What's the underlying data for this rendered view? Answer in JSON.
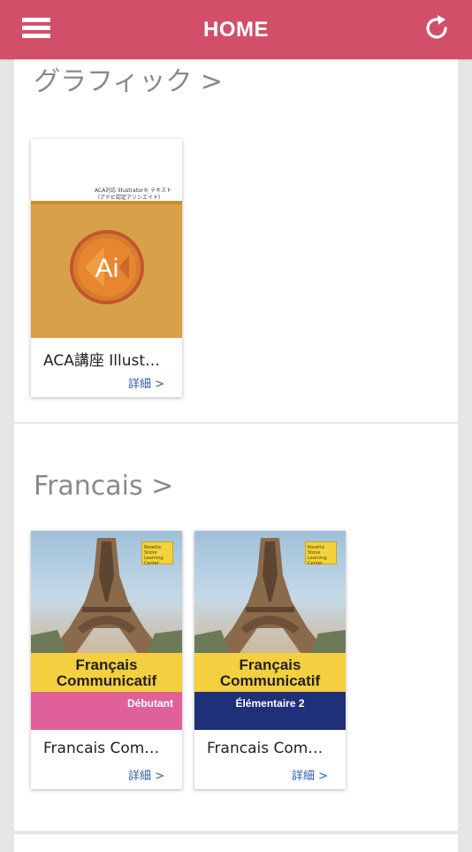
{
  "header": {
    "title": "HOME"
  },
  "sections": [
    {
      "title": "グラフィック >",
      "books": [
        {
          "title": "ACA講座 Illust…",
          "link": "詳細 >",
          "cover_text_1": "ACA対応 Illustrator® テキスト",
          "cover_text_2": "（アドビ認定アソシエイト）",
          "cover_logo": "Ai"
        }
      ]
    },
    {
      "title": "Francais >",
      "books": [
        {
          "title": "Francais Com…",
          "link": "詳細 >",
          "cover_brand": "Rosetta Stone",
          "cover_sub": "Learning Center",
          "cover_line1": "Français",
          "cover_line2": "Communicatif",
          "cover_level": "Débutant",
          "level_color": "#e0609a"
        },
        {
          "title": "Francais Com…",
          "link": "詳細 >",
          "cover_brand": "Rosetta Stone",
          "cover_sub": "Learning Center",
          "cover_line1": "Français",
          "cover_line2": "Communicatif",
          "cover_level": "Élémentaire 2",
          "level_color": "#1f2f7a"
        }
      ]
    }
  ],
  "colors": {
    "header": "#d24f69",
    "link": "#2a5fa8",
    "section_title": "#8a8a8a"
  },
  "icons": {
    "menu": "menu-icon",
    "refresh": "refresh-icon"
  }
}
